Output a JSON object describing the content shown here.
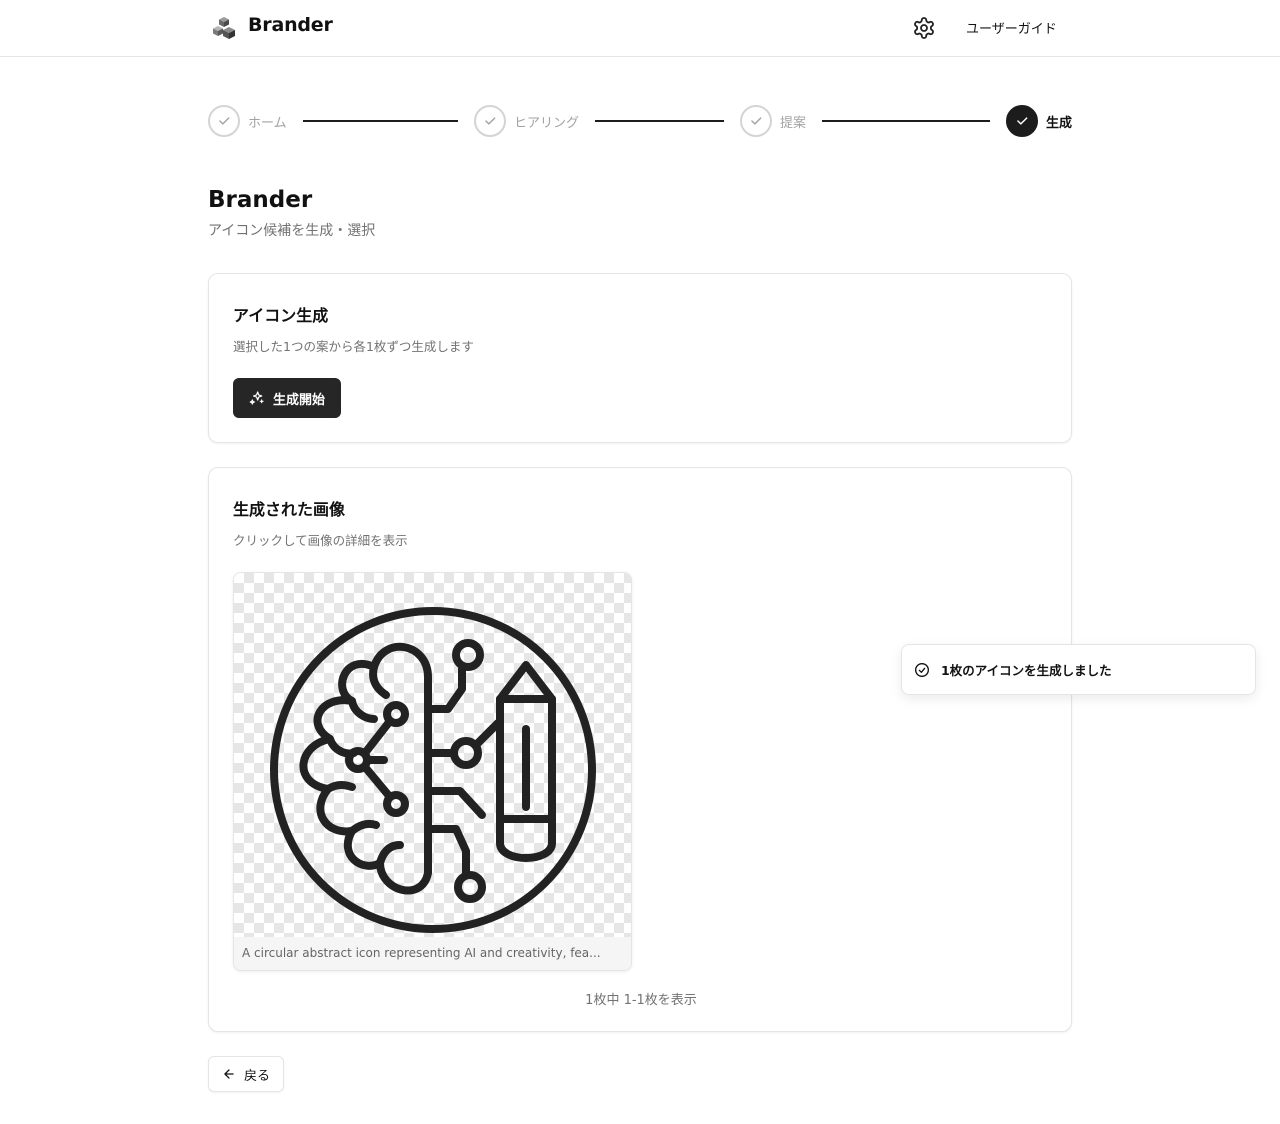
{
  "header": {
    "app_name": "Brander",
    "logo_icon": "cube-stack-icon",
    "settings_icon": "gear-icon",
    "user_guide_label": "ユーザーガイド"
  },
  "stepper": {
    "steps": [
      {
        "label": "ホーム",
        "status": "completed"
      },
      {
        "label": "ヒアリング",
        "status": "completed"
      },
      {
        "label": "提案",
        "status": "completed"
      },
      {
        "label": "生成",
        "status": "current"
      }
    ]
  },
  "page": {
    "title": "Brander",
    "subtitle": "アイコン候補を生成・選択"
  },
  "generate_card": {
    "title": "アイコン生成",
    "description": "選択した1つの案から各1枚ずつ生成します",
    "button_label": "生成開始",
    "button_icon": "sparkles-icon"
  },
  "results_card": {
    "title": "生成された画像",
    "description": "クリックして画像の詳細を表示",
    "images": [
      {
        "caption": "A circular abstract icon representing AI and creativity, fea...",
        "art": "brain-circuit-pencil-icon"
      }
    ],
    "pagination": "1枚中 1-1枚を表示"
  },
  "back_button": {
    "label": "戻る",
    "icon": "arrow-left-icon"
  },
  "toast": {
    "message": "1枚のアイコンを生成しました",
    "icon": "check-circle-icon"
  },
  "colors": {
    "primary": "#262626",
    "border": "#e5e5e5",
    "muted_text": "#737373",
    "inactive_step": "#a3a3a3"
  }
}
